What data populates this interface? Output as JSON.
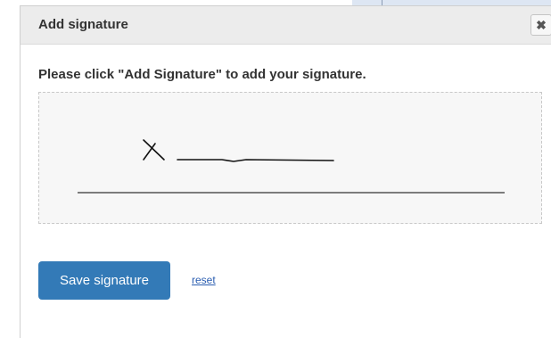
{
  "dialog": {
    "title": "Add signature",
    "close_icon": "close-icon",
    "close_glyph": "✖",
    "instructions": "Please click \"Add Signature\" to add your signature.",
    "signature_mark": "X",
    "save_label": "Save signature",
    "reset_label": "reset"
  },
  "colors": {
    "primary_button": "#337ab7",
    "titlebar": "#ececec",
    "pad_background": "#f7f7f7"
  }
}
